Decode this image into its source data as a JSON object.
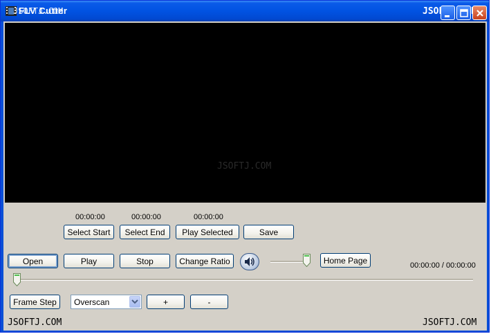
{
  "window": {
    "title": "FLV Cutter",
    "watermark_title_left": "JSOFTJ.COM",
    "watermark_title_right": "JSOFTJ.COM"
  },
  "video": {
    "watermark": "JSOFTJ.COM"
  },
  "selection": {
    "start_time": "00:00:00",
    "end_time": "00:00:00",
    "selected_time": "00:00:00",
    "select_start_label": "Select Start",
    "select_end_label": "Select End",
    "play_selected_label": "Play Selected",
    "save_label": "Save"
  },
  "controls": {
    "open_label": "Open",
    "play_label": "Play",
    "stop_label": "Stop",
    "change_ratio_label": "Change Ratio",
    "home_page_label": "Home Page",
    "time_display": "00:00:00 / 00:00:00",
    "volume_level": 1.0,
    "seek_position": 0.0
  },
  "bottom": {
    "frame_step_label": "Frame Step",
    "scan_mode": "Overscan",
    "plus_label": "+",
    "minus_label": "-",
    "watermark_left": "JSOFTJ.COM",
    "watermark_right": "JSOFTJ.COM"
  }
}
